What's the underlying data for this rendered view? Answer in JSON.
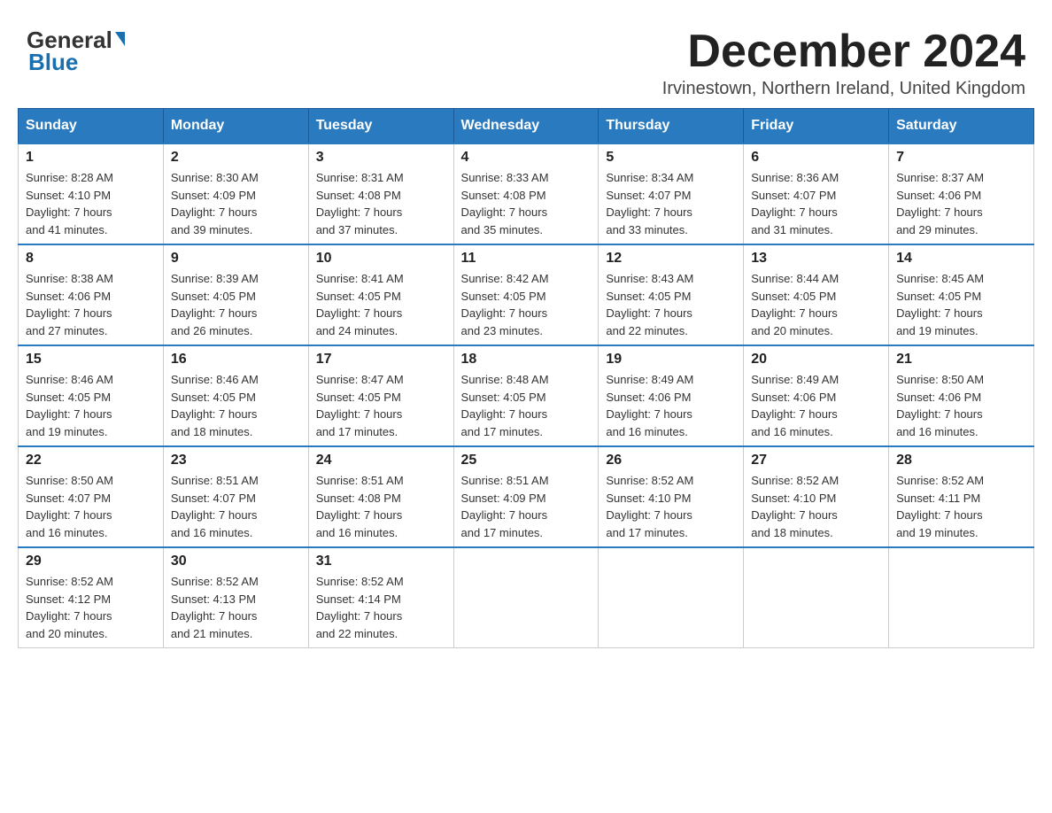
{
  "header": {
    "logo_general": "General",
    "logo_blue": "Blue",
    "month_title": "December 2024",
    "location": "Irvinestown, Northern Ireland, United Kingdom"
  },
  "days_of_week": [
    "Sunday",
    "Monday",
    "Tuesday",
    "Wednesday",
    "Thursday",
    "Friday",
    "Saturday"
  ],
  "weeks": [
    [
      {
        "day": "1",
        "sunrise": "8:28 AM",
        "sunset": "4:10 PM",
        "daylight": "7 hours and 41 minutes."
      },
      {
        "day": "2",
        "sunrise": "8:30 AM",
        "sunset": "4:09 PM",
        "daylight": "7 hours and 39 minutes."
      },
      {
        "day": "3",
        "sunrise": "8:31 AM",
        "sunset": "4:08 PM",
        "daylight": "7 hours and 37 minutes."
      },
      {
        "day": "4",
        "sunrise": "8:33 AM",
        "sunset": "4:08 PM",
        "daylight": "7 hours and 35 minutes."
      },
      {
        "day": "5",
        "sunrise": "8:34 AM",
        "sunset": "4:07 PM",
        "daylight": "7 hours and 33 minutes."
      },
      {
        "day": "6",
        "sunrise": "8:36 AM",
        "sunset": "4:07 PM",
        "daylight": "7 hours and 31 minutes."
      },
      {
        "day": "7",
        "sunrise": "8:37 AM",
        "sunset": "4:06 PM",
        "daylight": "7 hours and 29 minutes."
      }
    ],
    [
      {
        "day": "8",
        "sunrise": "8:38 AM",
        "sunset": "4:06 PM",
        "daylight": "7 hours and 27 minutes."
      },
      {
        "day": "9",
        "sunrise": "8:39 AM",
        "sunset": "4:05 PM",
        "daylight": "7 hours and 26 minutes."
      },
      {
        "day": "10",
        "sunrise": "8:41 AM",
        "sunset": "4:05 PM",
        "daylight": "7 hours and 24 minutes."
      },
      {
        "day": "11",
        "sunrise": "8:42 AM",
        "sunset": "4:05 PM",
        "daylight": "7 hours and 23 minutes."
      },
      {
        "day": "12",
        "sunrise": "8:43 AM",
        "sunset": "4:05 PM",
        "daylight": "7 hours and 22 minutes."
      },
      {
        "day": "13",
        "sunrise": "8:44 AM",
        "sunset": "4:05 PM",
        "daylight": "7 hours and 20 minutes."
      },
      {
        "day": "14",
        "sunrise": "8:45 AM",
        "sunset": "4:05 PM",
        "daylight": "7 hours and 19 minutes."
      }
    ],
    [
      {
        "day": "15",
        "sunrise": "8:46 AM",
        "sunset": "4:05 PM",
        "daylight": "7 hours and 19 minutes."
      },
      {
        "day": "16",
        "sunrise": "8:46 AM",
        "sunset": "4:05 PM",
        "daylight": "7 hours and 18 minutes."
      },
      {
        "day": "17",
        "sunrise": "8:47 AM",
        "sunset": "4:05 PM",
        "daylight": "7 hours and 17 minutes."
      },
      {
        "day": "18",
        "sunrise": "8:48 AM",
        "sunset": "4:05 PM",
        "daylight": "7 hours and 17 minutes."
      },
      {
        "day": "19",
        "sunrise": "8:49 AM",
        "sunset": "4:06 PM",
        "daylight": "7 hours and 16 minutes."
      },
      {
        "day": "20",
        "sunrise": "8:49 AM",
        "sunset": "4:06 PM",
        "daylight": "7 hours and 16 minutes."
      },
      {
        "day": "21",
        "sunrise": "8:50 AM",
        "sunset": "4:06 PM",
        "daylight": "7 hours and 16 minutes."
      }
    ],
    [
      {
        "day": "22",
        "sunrise": "8:50 AM",
        "sunset": "4:07 PM",
        "daylight": "7 hours and 16 minutes."
      },
      {
        "day": "23",
        "sunrise": "8:51 AM",
        "sunset": "4:07 PM",
        "daylight": "7 hours and 16 minutes."
      },
      {
        "day": "24",
        "sunrise": "8:51 AM",
        "sunset": "4:08 PM",
        "daylight": "7 hours and 16 minutes."
      },
      {
        "day": "25",
        "sunrise": "8:51 AM",
        "sunset": "4:09 PM",
        "daylight": "7 hours and 17 minutes."
      },
      {
        "day": "26",
        "sunrise": "8:52 AM",
        "sunset": "4:10 PM",
        "daylight": "7 hours and 17 minutes."
      },
      {
        "day": "27",
        "sunrise": "8:52 AM",
        "sunset": "4:10 PM",
        "daylight": "7 hours and 18 minutes."
      },
      {
        "day": "28",
        "sunrise": "8:52 AM",
        "sunset": "4:11 PM",
        "daylight": "7 hours and 19 minutes."
      }
    ],
    [
      {
        "day": "29",
        "sunrise": "8:52 AM",
        "sunset": "4:12 PM",
        "daylight": "7 hours and 20 minutes."
      },
      {
        "day": "30",
        "sunrise": "8:52 AM",
        "sunset": "4:13 PM",
        "daylight": "7 hours and 21 minutes."
      },
      {
        "day": "31",
        "sunrise": "8:52 AM",
        "sunset": "4:14 PM",
        "daylight": "7 hours and 22 minutes."
      },
      null,
      null,
      null,
      null
    ]
  ],
  "labels": {
    "sunrise": "Sunrise:",
    "sunset": "Sunset:",
    "daylight": "Daylight:"
  }
}
